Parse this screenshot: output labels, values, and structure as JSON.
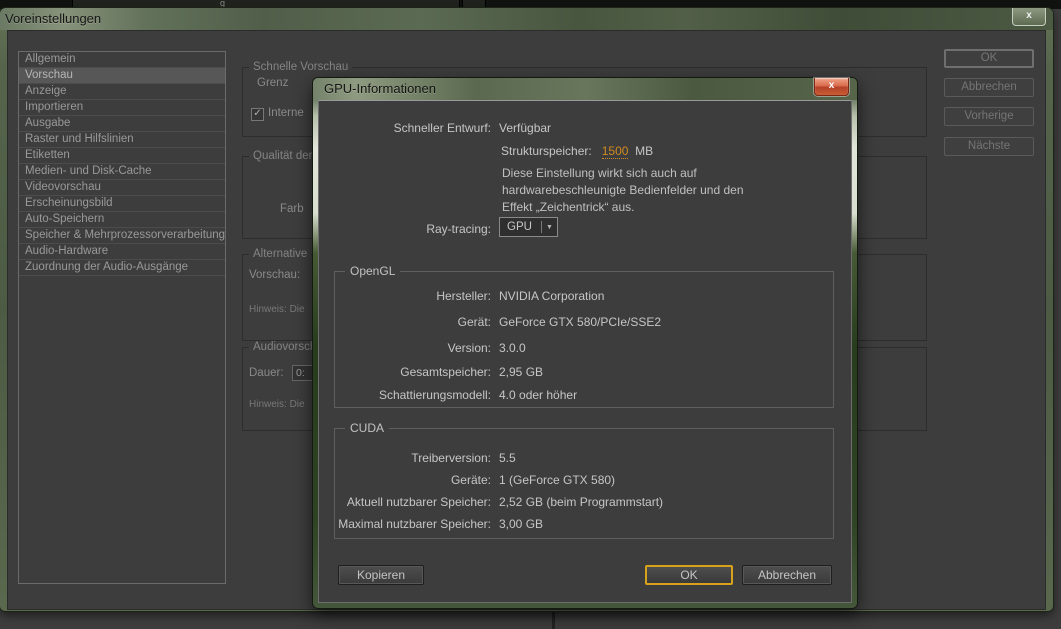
{
  "colors": {
    "titlebar_green": "#5e6c50",
    "content_bg": "#3d3d3d",
    "hot_text_orange": "#d28b20",
    "ok_border_gold": "#d9a21b",
    "close_button_red": "#c14a2a"
  },
  "app_strip": {
    "fragment": "g"
  },
  "main_window": {
    "title": "Voreinstellungen",
    "close_label": "x",
    "sidebar": {
      "selected": "Vorschau",
      "items": [
        "Allgemein",
        "Vorschau",
        "Anzeige",
        "Importieren",
        "Ausgabe",
        "Raster und Hilfslinien",
        "Etiketten",
        "Medien- und Disk-Cache",
        "Videovorschau",
        "Erscheinungsbild",
        "Auto-Speichern",
        "Speicher & Mehrprozessorverarbeitung",
        "Audio-Hardware",
        "Zuordnung der Audio-Ausgänge"
      ]
    },
    "buttons": {
      "ok": "OK",
      "cancel": "Abbrechen",
      "previous": "Vorherige",
      "next": "Nächste"
    },
    "groups": {
      "fast_preview": {
        "title": "Schnelle Vorschau",
        "limit_label": "Grenz",
        "checkbox_label": "Interne",
        "checkbox_checked": true,
        "checkmark": "✓"
      },
      "quality": {
        "title": "Qualität der",
        "color_label": "Farb"
      },
      "alternative": {
        "title": "Alternative",
        "preview_label": "Vorschau:",
        "hint_label": "Hinweis: Die"
      },
      "audio_preview": {
        "title": "Audiovorsch",
        "duration_label": "Dauer:",
        "duration_value": "0:",
        "hint_label": "Hinweis: Die"
      }
    }
  },
  "gpu_dialog": {
    "title": "GPU-Informationen",
    "close_label": "x",
    "fast_draft": {
      "label": "Schneller Entwurf:",
      "value": "Verfügbar"
    },
    "texture_memory": {
      "label": "Strukturspeicher:",
      "value": "1500",
      "unit": "MB",
      "note": "Diese Einstellung wirkt sich auch auf\nhardwarebeschleunigte Bedienfelder und den\nEffekt „Zeichentrick“ aus."
    },
    "ray_tracing": {
      "label": "Ray-tracing:",
      "value": "GPU",
      "arrow": "▼"
    },
    "opengl": {
      "title": "OpenGL",
      "rows": [
        {
          "label": "Hersteller:",
          "value": "NVIDIA Corporation"
        },
        {
          "label": "Gerät:",
          "value": "GeForce GTX 580/PCIe/SSE2"
        },
        {
          "label": "Version:",
          "value": "3.0.0"
        },
        {
          "label": "Gesamtspeicher:",
          "value": "2,95 GB"
        },
        {
          "label": "Schattierungsmodell:",
          "value": "4.0 oder höher"
        }
      ]
    },
    "cuda": {
      "title": "CUDA",
      "rows": [
        {
          "label": "Treiberversion:",
          "value": "5.5"
        },
        {
          "label": "Geräte:",
          "value": "1 (GeForce GTX 580)"
        },
        {
          "label": "Aktuell nutzbarer Speicher:",
          "value": "2,52 GB (beim Programmstart)"
        },
        {
          "label": "Maximal nutzbarer Speicher:",
          "value": "3,00 GB"
        }
      ]
    },
    "buttons": {
      "copy": "Kopieren",
      "ok": "OK",
      "cancel": "Abbrechen"
    }
  }
}
